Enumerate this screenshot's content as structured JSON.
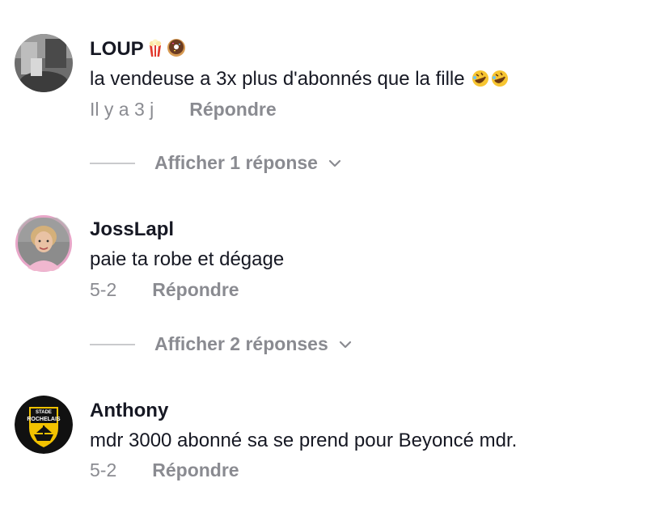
{
  "comments": [
    {
      "username": "LOUP",
      "username_emojis": [
        "popcorn-icon",
        "donut-icon"
      ],
      "text": "la vendeuse a 3x plus d'abonnés que la fille",
      "text_emojis": [
        "rofl-emoji",
        "rofl-emoji"
      ],
      "time": "Il y a 3 j",
      "reply_label": "Répondre",
      "replies_label": "Afficher 1 réponse"
    },
    {
      "username": "JossLapl",
      "text": "paie ta robe et dégage",
      "time": "5-2",
      "reply_label": "Répondre",
      "replies_label": "Afficher 2 réponses"
    },
    {
      "username": "Anthony",
      "text": "mdr 3000 abonné sa se prend pour Beyoncé mdr.",
      "time": "5-2",
      "reply_label": "Répondre",
      "avatar_badge": {
        "line1": "STADE",
        "line2": "ROCHELAIS"
      }
    }
  ],
  "colors": {
    "text": "#161823",
    "secondary": "#8a8b91",
    "divider": "#c9cacd",
    "avatar_ring": "#e0a0c0",
    "badge_yellow": "#f2c200"
  }
}
